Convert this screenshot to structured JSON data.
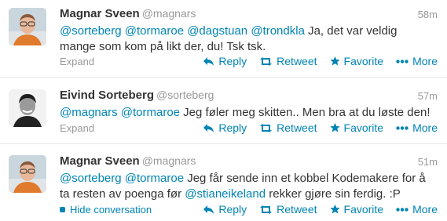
{
  "tweets": [
    {
      "fullname": "Magnar Sveen",
      "username": "@magnars",
      "time": "58m",
      "text_parts": [
        {
          "type": "mention",
          "text": "@sorteberg"
        },
        {
          "type": "plain",
          "text": " "
        },
        {
          "type": "mention",
          "text": "@tormaroe"
        },
        {
          "type": "plain",
          "text": " "
        },
        {
          "type": "mention",
          "text": "@dagstuan"
        },
        {
          "type": "plain",
          "text": " "
        },
        {
          "type": "mention",
          "text": "@trondkla"
        },
        {
          "type": "plain",
          "text": " Ja, det var veldig mange som kom på likt der, du! Tsk tsk."
        }
      ],
      "footer_link": "Expand",
      "avatar": "person-glasses-orange-sweater"
    },
    {
      "fullname": "Eivind Sorteberg",
      "username": "@sorteberg",
      "time": "57m",
      "text_parts": [
        {
          "type": "mention",
          "text": "@magnars"
        },
        {
          "type": "plain",
          "text": " "
        },
        {
          "type": "mention",
          "text": "@tormaroe"
        },
        {
          "type": "plain",
          "text": " Jeg føler meg skitten.. Men bra at du løste den!"
        }
      ],
      "footer_link": "Expand",
      "avatar": "person-black-white-smile"
    },
    {
      "fullname": "Magnar Sveen",
      "username": "@magnars",
      "time": "51m",
      "text_parts": [
        {
          "type": "mention",
          "text": "@sorteberg"
        },
        {
          "type": "plain",
          "text": " "
        },
        {
          "type": "mention",
          "text": "@tormaroe"
        },
        {
          "type": "plain",
          "text": " Jeg får sende inn et kobbel Kodemakere for å ta resten av poenga før "
        },
        {
          "type": "mention",
          "text": "@stianeikeland"
        },
        {
          "type": "plain",
          "text": " rekker gjøre sin ferdig. :P"
        }
      ],
      "footer_link": "Hide conversation",
      "avatar": "person-glasses-orange-sweater"
    }
  ],
  "actions": {
    "reply": "Reply",
    "retweet": "Retweet",
    "favorite": "Favorite",
    "more": "More"
  },
  "colors": {
    "link": "#0084b4",
    "muted": "#999999",
    "text": "#333333"
  }
}
